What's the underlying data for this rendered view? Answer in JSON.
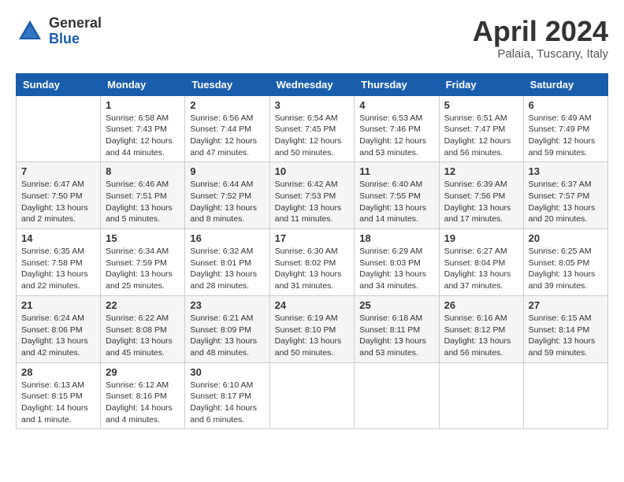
{
  "header": {
    "logo_general": "General",
    "logo_blue": "Blue",
    "month_title": "April 2024",
    "location": "Palaia, Tuscany, Italy"
  },
  "days_of_week": [
    "Sunday",
    "Monday",
    "Tuesday",
    "Wednesday",
    "Thursday",
    "Friday",
    "Saturday"
  ],
  "weeks": [
    [
      {
        "day": "",
        "info": ""
      },
      {
        "day": "1",
        "info": "Sunrise: 6:58 AM\nSunset: 7:43 PM\nDaylight: 12 hours\nand 44 minutes."
      },
      {
        "day": "2",
        "info": "Sunrise: 6:56 AM\nSunset: 7:44 PM\nDaylight: 12 hours\nand 47 minutes."
      },
      {
        "day": "3",
        "info": "Sunrise: 6:54 AM\nSunset: 7:45 PM\nDaylight: 12 hours\nand 50 minutes."
      },
      {
        "day": "4",
        "info": "Sunrise: 6:53 AM\nSunset: 7:46 PM\nDaylight: 12 hours\nand 53 minutes."
      },
      {
        "day": "5",
        "info": "Sunrise: 6:51 AM\nSunset: 7:47 PM\nDaylight: 12 hours\nand 56 minutes."
      },
      {
        "day": "6",
        "info": "Sunrise: 6:49 AM\nSunset: 7:49 PM\nDaylight: 12 hours\nand 59 minutes."
      }
    ],
    [
      {
        "day": "7",
        "info": "Sunrise: 6:47 AM\nSunset: 7:50 PM\nDaylight: 13 hours\nand 2 minutes."
      },
      {
        "day": "8",
        "info": "Sunrise: 6:46 AM\nSunset: 7:51 PM\nDaylight: 13 hours\nand 5 minutes."
      },
      {
        "day": "9",
        "info": "Sunrise: 6:44 AM\nSunset: 7:52 PM\nDaylight: 13 hours\nand 8 minutes."
      },
      {
        "day": "10",
        "info": "Sunrise: 6:42 AM\nSunset: 7:53 PM\nDaylight: 13 hours\nand 11 minutes."
      },
      {
        "day": "11",
        "info": "Sunrise: 6:40 AM\nSunset: 7:55 PM\nDaylight: 13 hours\nand 14 minutes."
      },
      {
        "day": "12",
        "info": "Sunrise: 6:39 AM\nSunset: 7:56 PM\nDaylight: 13 hours\nand 17 minutes."
      },
      {
        "day": "13",
        "info": "Sunrise: 6:37 AM\nSunset: 7:57 PM\nDaylight: 13 hours\nand 20 minutes."
      }
    ],
    [
      {
        "day": "14",
        "info": "Sunrise: 6:35 AM\nSunset: 7:58 PM\nDaylight: 13 hours\nand 22 minutes."
      },
      {
        "day": "15",
        "info": "Sunrise: 6:34 AM\nSunset: 7:59 PM\nDaylight: 13 hours\nand 25 minutes."
      },
      {
        "day": "16",
        "info": "Sunrise: 6:32 AM\nSunset: 8:01 PM\nDaylight: 13 hours\nand 28 minutes."
      },
      {
        "day": "17",
        "info": "Sunrise: 6:30 AM\nSunset: 8:02 PM\nDaylight: 13 hours\nand 31 minutes."
      },
      {
        "day": "18",
        "info": "Sunrise: 6:29 AM\nSunset: 8:03 PM\nDaylight: 13 hours\nand 34 minutes."
      },
      {
        "day": "19",
        "info": "Sunrise: 6:27 AM\nSunset: 8:04 PM\nDaylight: 13 hours\nand 37 minutes."
      },
      {
        "day": "20",
        "info": "Sunrise: 6:25 AM\nSunset: 8:05 PM\nDaylight: 13 hours\nand 39 minutes."
      }
    ],
    [
      {
        "day": "21",
        "info": "Sunrise: 6:24 AM\nSunset: 8:06 PM\nDaylight: 13 hours\nand 42 minutes."
      },
      {
        "day": "22",
        "info": "Sunrise: 6:22 AM\nSunset: 8:08 PM\nDaylight: 13 hours\nand 45 minutes."
      },
      {
        "day": "23",
        "info": "Sunrise: 6:21 AM\nSunset: 8:09 PM\nDaylight: 13 hours\nand 48 minutes."
      },
      {
        "day": "24",
        "info": "Sunrise: 6:19 AM\nSunset: 8:10 PM\nDaylight: 13 hours\nand 50 minutes."
      },
      {
        "day": "25",
        "info": "Sunrise: 6:18 AM\nSunset: 8:11 PM\nDaylight: 13 hours\nand 53 minutes."
      },
      {
        "day": "26",
        "info": "Sunrise: 6:16 AM\nSunset: 8:12 PM\nDaylight: 13 hours\nand 56 minutes."
      },
      {
        "day": "27",
        "info": "Sunrise: 6:15 AM\nSunset: 8:14 PM\nDaylight: 13 hours\nand 59 minutes."
      }
    ],
    [
      {
        "day": "28",
        "info": "Sunrise: 6:13 AM\nSunset: 8:15 PM\nDaylight: 14 hours\nand 1 minute."
      },
      {
        "day": "29",
        "info": "Sunrise: 6:12 AM\nSunset: 8:16 PM\nDaylight: 14 hours\nand 4 minutes."
      },
      {
        "day": "30",
        "info": "Sunrise: 6:10 AM\nSunset: 8:17 PM\nDaylight: 14 hours\nand 6 minutes."
      },
      {
        "day": "",
        "info": ""
      },
      {
        "day": "",
        "info": ""
      },
      {
        "day": "",
        "info": ""
      },
      {
        "day": "",
        "info": ""
      }
    ]
  ]
}
